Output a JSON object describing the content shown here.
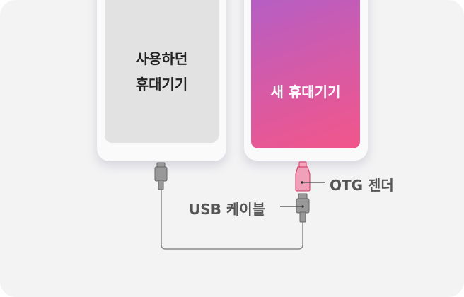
{
  "old_device": {
    "label_line1": "사용하던",
    "label_line2": "휴대기기"
  },
  "new_device": {
    "label": "새 휴대기기"
  },
  "labels": {
    "otg": "OTG 젠더",
    "usb": "USB 케이블"
  },
  "colors": {
    "gradient_start": "#b05fc9",
    "gradient_end": "#f2568a",
    "otg": "#f0a0b8",
    "cable": "#8a8a8a"
  }
}
